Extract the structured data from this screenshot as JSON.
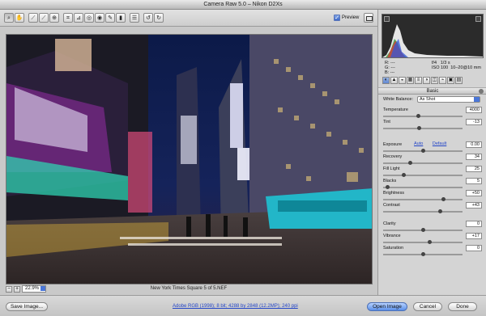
{
  "window": {
    "title": "Camera Raw 5.0  –  Nikon D2Xs"
  },
  "toolbar": {
    "tools": [
      {
        "icon": "zoom-icon",
        "glyph": "⌕"
      },
      {
        "icon": "hand-icon",
        "glyph": "✋"
      },
      {
        "icon": "white-balance-icon",
        "glyph": "⟋"
      },
      {
        "icon": "color-sampler-icon",
        "glyph": "⟋"
      },
      {
        "icon": "targeted-adjustment-icon",
        "glyph": "⊕"
      },
      {
        "icon": "crop-icon",
        "glyph": "⌗"
      },
      {
        "icon": "straighten-icon",
        "glyph": "⊿"
      },
      {
        "icon": "spot-removal-icon",
        "glyph": "◎"
      },
      {
        "icon": "red-eye-icon",
        "glyph": "◉"
      },
      {
        "icon": "adjustment-brush-icon",
        "glyph": "✎"
      },
      {
        "icon": "graduated-filter-icon",
        "glyph": "▮"
      },
      {
        "icon": "preferences-icon",
        "glyph": "☰"
      },
      {
        "icon": "rotate-left-icon",
        "glyph": "↺"
      },
      {
        "icon": "rotate-right-icon",
        "glyph": "↻"
      }
    ],
    "preview_label": "Preview",
    "preview_checked": true
  },
  "camera_info": {
    "r": "R:",
    "g": "G:",
    "b": "B:",
    "r_val": "---",
    "g_val": "---",
    "b_val": "---",
    "aperture": "f/4",
    "shutter": "1/3 s",
    "iso": "ISO 100",
    "lens": "10–20@10 mm"
  },
  "panel": {
    "tabs": [
      "◐",
      "▲",
      "◒",
      "▦",
      "≡",
      "◑",
      "◫",
      "⌁",
      "▣",
      "▤"
    ],
    "section_title": "Basic",
    "white_balance_label": "White Balance:",
    "white_balance_value": "As Shot",
    "auto_label": "Auto",
    "default_label": "Default",
    "sliders": [
      {
        "label": "Temperature",
        "value": "4000",
        "pos": 0.44
      },
      {
        "label": "Tint",
        "value": "-13",
        "pos": 0.45
      },
      {
        "label": "Exposure",
        "value": "0.00",
        "pos": 0.5
      },
      {
        "label": "Recovery",
        "value": "34",
        "pos": 0.34
      },
      {
        "label": "Fill Light",
        "value": "25",
        "pos": 0.25
      },
      {
        "label": "Blacks",
        "value": "5",
        "pos": 0.05
      },
      {
        "label": "Brightness",
        "value": "+50",
        "pos": 0.75
      },
      {
        "label": "Contrast",
        "value": "+43",
        "pos": 0.71
      },
      {
        "label": "Clarity",
        "value": "0",
        "pos": 0.5
      },
      {
        "label": "Vibrance",
        "value": "+17",
        "pos": 0.58
      },
      {
        "label": "Saturation",
        "value": "0",
        "pos": 0.5
      }
    ]
  },
  "status": {
    "zoom_minus": "−",
    "zoom_plus": "+",
    "zoom_value": "22.9%",
    "filename": "New York Times Square 5 of 5.NEF"
  },
  "bottom": {
    "save_image": "Save Image...",
    "workflow_link": "Adobe RGB (1998); 8 bit; 4288 by 2848 (12.2MP); 240 ppi",
    "open_image": "Open Image",
    "cancel": "Cancel",
    "done": "Done"
  }
}
